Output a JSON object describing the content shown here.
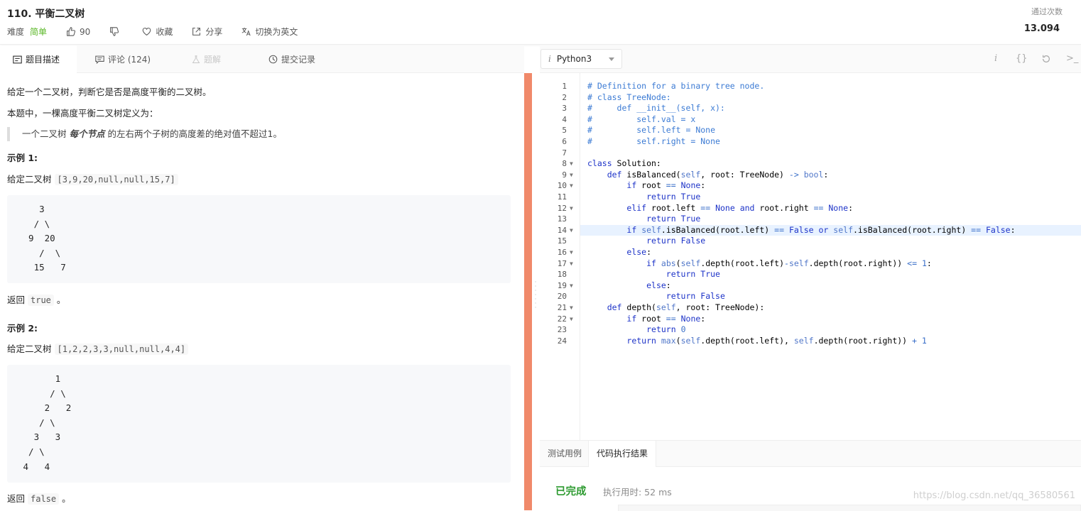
{
  "header": {
    "title": "110. 平衡二叉树",
    "difficulty_label": "难度",
    "difficulty_value": "简单",
    "likes": "90",
    "favorite": "收藏",
    "share": "分享",
    "switch_lang": "切换为英文",
    "accept_label": "通过次数",
    "accept_value": "13.094"
  },
  "tabs": {
    "description": "题目描述",
    "comments": "评论 (124)",
    "solution": "题解",
    "submissions": "提交记录"
  },
  "problem": {
    "p1": "给定一个二叉树，判断它是否是高度平衡的二叉树。",
    "p2": "本题中，一棵高度平衡二叉树定义为：",
    "quote_pre": "一个二叉树",
    "quote_em": "每个节点",
    "quote_post": "的左右两个子树的高度差的绝对值不超过1。",
    "ex1_title": "示例 1:",
    "ex1_given": "给定二叉树",
    "ex1_input": "[3,9,20,null,null,15,7]",
    "ex1_tree": [
      "    3",
      "   / \\",
      "  9  20",
      "    /  \\",
      "   15   7"
    ],
    "ex1_return": "返回",
    "ex1_value": "true",
    "ex1_end": "。",
    "ex2_title": "示例 2:",
    "ex2_given": "给定二叉树",
    "ex2_input": "[1,2,2,3,3,null,null,4,4]",
    "ex2_tree": [
      "       1",
      "      / \\",
      "     2   2",
      "    / \\",
      "   3   3",
      "  / \\",
      " 4   4"
    ],
    "ex2_return": "返回",
    "ex2_value": "false",
    "ex2_end": "。"
  },
  "editor": {
    "language": "Python3",
    "lines": [
      "# Definition for a binary tree node.",
      "# class TreeNode:",
      "#     def __init__(self, x):",
      "#         self.val = x",
      "#         self.left = None",
      "#         self.right = None",
      "",
      "class Solution:",
      "    def isBalanced(self, root: TreeNode) -> bool:",
      "        if root == None:",
      "            return True",
      "        elif root.left == None and root.right == None:",
      "            return True",
      "        if self.isBalanced(root.left) == False or self.isBalanced(root.right) == False:",
      "            return False",
      "        else:",
      "            if abs(self.depth(root.left)-self.depth(root.right)) <= 1:",
      "                return True",
      "            else:",
      "                return False",
      "    def depth(self, root: TreeNode):",
      "        if root == None:",
      "            return 0",
      "        return max(self.depth(root.left), self.depth(root.right)) + 1"
    ],
    "foldable_lines": [
      8,
      9,
      10,
      12,
      14,
      16,
      17,
      19,
      21,
      22
    ],
    "highlight_line": 14
  },
  "bottom": {
    "tab_testcase": "测试用例",
    "tab_result": "代码执行结果",
    "status": "已完成",
    "runtime": "执行用时: 52 ms",
    "watermark": "https://blog.csdn.net/qq_36580561"
  },
  "colors": {
    "accent": "#f0896a",
    "easy": "#5ab726",
    "success": "#2e9b31"
  }
}
